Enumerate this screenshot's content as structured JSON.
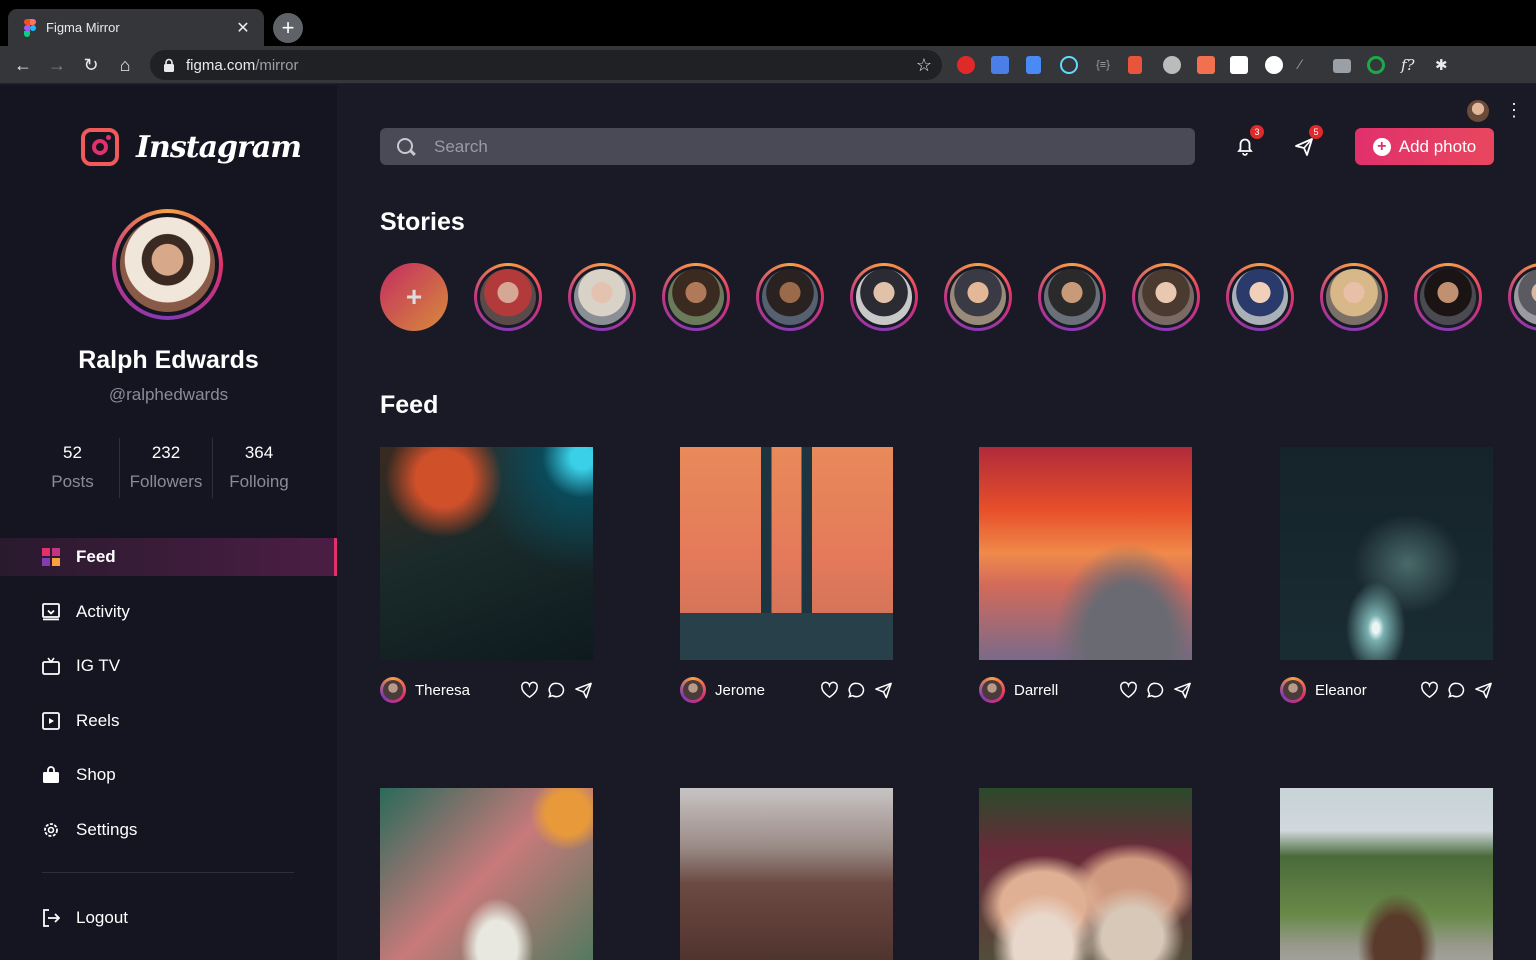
{
  "browser": {
    "tab_title": "Figma Mirror",
    "url_host": "figma.com",
    "url_path": "/mirror"
  },
  "sidebar": {
    "brand": "Instagram",
    "profile": {
      "name": "Ralph Edwards",
      "handle": "@ralphedwards"
    },
    "stats": [
      {
        "value": "52",
        "label": "Posts"
      },
      {
        "value": "232",
        "label": "Followers"
      },
      {
        "value": "364",
        "label": "Folloing"
      }
    ],
    "menu": [
      {
        "label": "Feed",
        "icon": "grid-icon",
        "active": true
      },
      {
        "label": "Activity",
        "icon": "activity-icon"
      },
      {
        "label": "IG TV",
        "icon": "tv-icon"
      },
      {
        "label": "Reels",
        "icon": "reels-icon"
      },
      {
        "label": "Shop",
        "icon": "shop-icon"
      },
      {
        "label": "Settings",
        "icon": "gear-icon"
      }
    ],
    "logout": "Logout"
  },
  "header": {
    "search_placeholder": "Search",
    "notifications_count": "3",
    "messages_count": "5",
    "add_photo_label": "Add photo"
  },
  "stories": {
    "title": "Stories"
  },
  "feed": {
    "title": "Feed",
    "posts": [
      {
        "user": "Theresa"
      },
      {
        "user": "Jerome"
      },
      {
        "user": "Darrell"
      },
      {
        "user": "Eleanor"
      },
      {
        "user": ""
      },
      {
        "user": ""
      },
      {
        "user": ""
      },
      {
        "user": ""
      }
    ]
  },
  "colors": {
    "accent": "#e1306c",
    "sidebar_bg": "#151521",
    "main_bg": "#1a1a26"
  }
}
